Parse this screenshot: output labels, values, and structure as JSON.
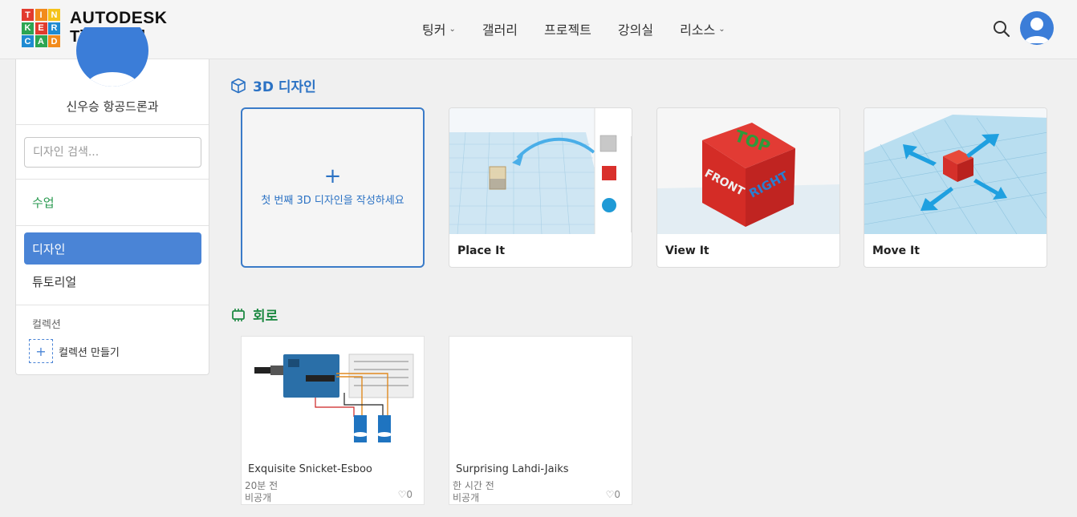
{
  "header": {
    "logo_letters": [
      "T",
      "I",
      "N",
      "K",
      "E",
      "R",
      "C",
      "A",
      "D"
    ],
    "logo_colors": [
      "#e23b2e",
      "#f28b1c",
      "#f5c31a",
      "#2da552",
      "#e23b2e",
      "#1f8bd2",
      "#1f8bd2",
      "#2da552",
      "#f28b1c"
    ],
    "brand_line1": "AUTODESK",
    "brand_line2": "Tinkercad",
    "nav": [
      {
        "label": "팅커",
        "has_dropdown": true
      },
      {
        "label": "갤러리",
        "has_dropdown": false
      },
      {
        "label": "프로젝트",
        "has_dropdown": false
      },
      {
        "label": "강의실",
        "has_dropdown": false
      },
      {
        "label": "리소스",
        "has_dropdown": true
      }
    ],
    "accent": "#3b7dd8"
  },
  "sidebar": {
    "user_name": "신우승 항공드론과",
    "search_placeholder": "디자인 검색...",
    "classes_label": "수업",
    "items": [
      {
        "label": "디자인",
        "active": true
      },
      {
        "label": "튜토리얼",
        "active": false
      }
    ],
    "collections_heading": "컬렉션",
    "create_collection_label": "컬렉션 만들기"
  },
  "main": {
    "designs_title": "3D 디자인",
    "new_design_label": "첫 번째 3D 디자인을 작성하세요",
    "design_cards": [
      {
        "title": "Place It"
      },
      {
        "title": "View It",
        "cube_labels": [
          "TOP",
          "FRONT",
          "RIGHT"
        ]
      },
      {
        "title": "Move It"
      }
    ],
    "circuits_title": "회로",
    "circuit_cards": [
      {
        "name": "Exquisite Snicket-Esboo",
        "time": "20분 전",
        "visibility": "비공개",
        "likes": "0"
      },
      {
        "name": "Surprising Lahdi-Jaiks",
        "time": "한 시간 전",
        "visibility": "비공개",
        "likes": "0"
      }
    ]
  }
}
